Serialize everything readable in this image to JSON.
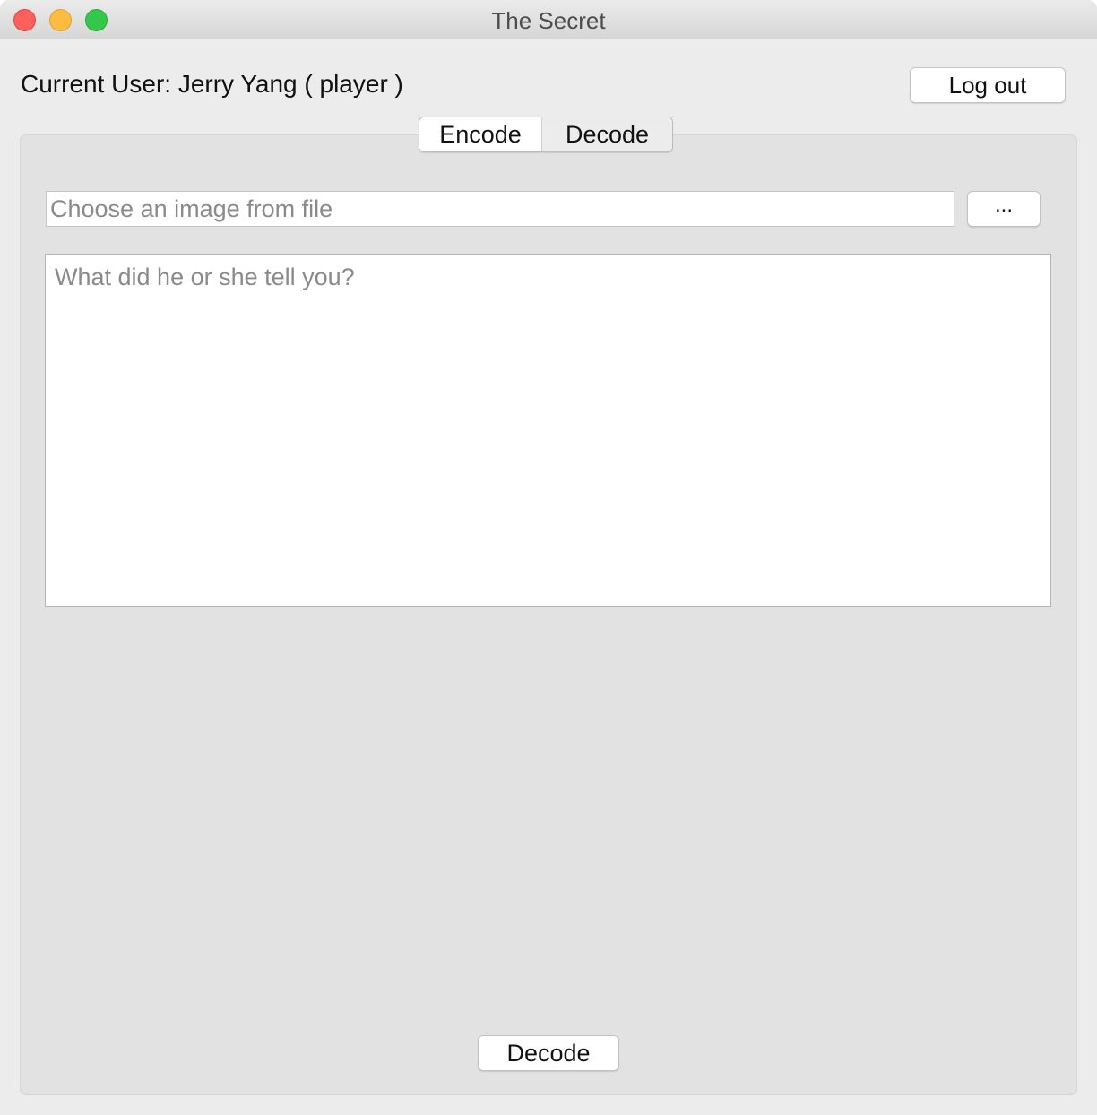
{
  "window": {
    "title": "The Secret"
  },
  "header": {
    "current_user_text": "Current User: Jerry Yang ( player )",
    "logout_label": "Log out"
  },
  "tabs": [
    {
      "label": "Encode",
      "selected": true
    },
    {
      "label": "Decode",
      "selected": false
    }
  ],
  "decode_form": {
    "file_input": {
      "value": "",
      "placeholder": "Choose an image from file"
    },
    "browse_label": "...",
    "message": {
      "value": "",
      "placeholder": "What did he or she tell you?"
    },
    "submit_label": "Decode"
  },
  "colors": {
    "window_bg": "#ececec",
    "panel_bg": "#e2e2e2",
    "close": "#fc605c",
    "minimize": "#fdbc40",
    "maximize": "#34c84a",
    "placeholder_text": "#8a8a8a"
  },
  "icons": [
    "close-window-icon",
    "minimize-window-icon",
    "maximize-window-icon"
  ]
}
